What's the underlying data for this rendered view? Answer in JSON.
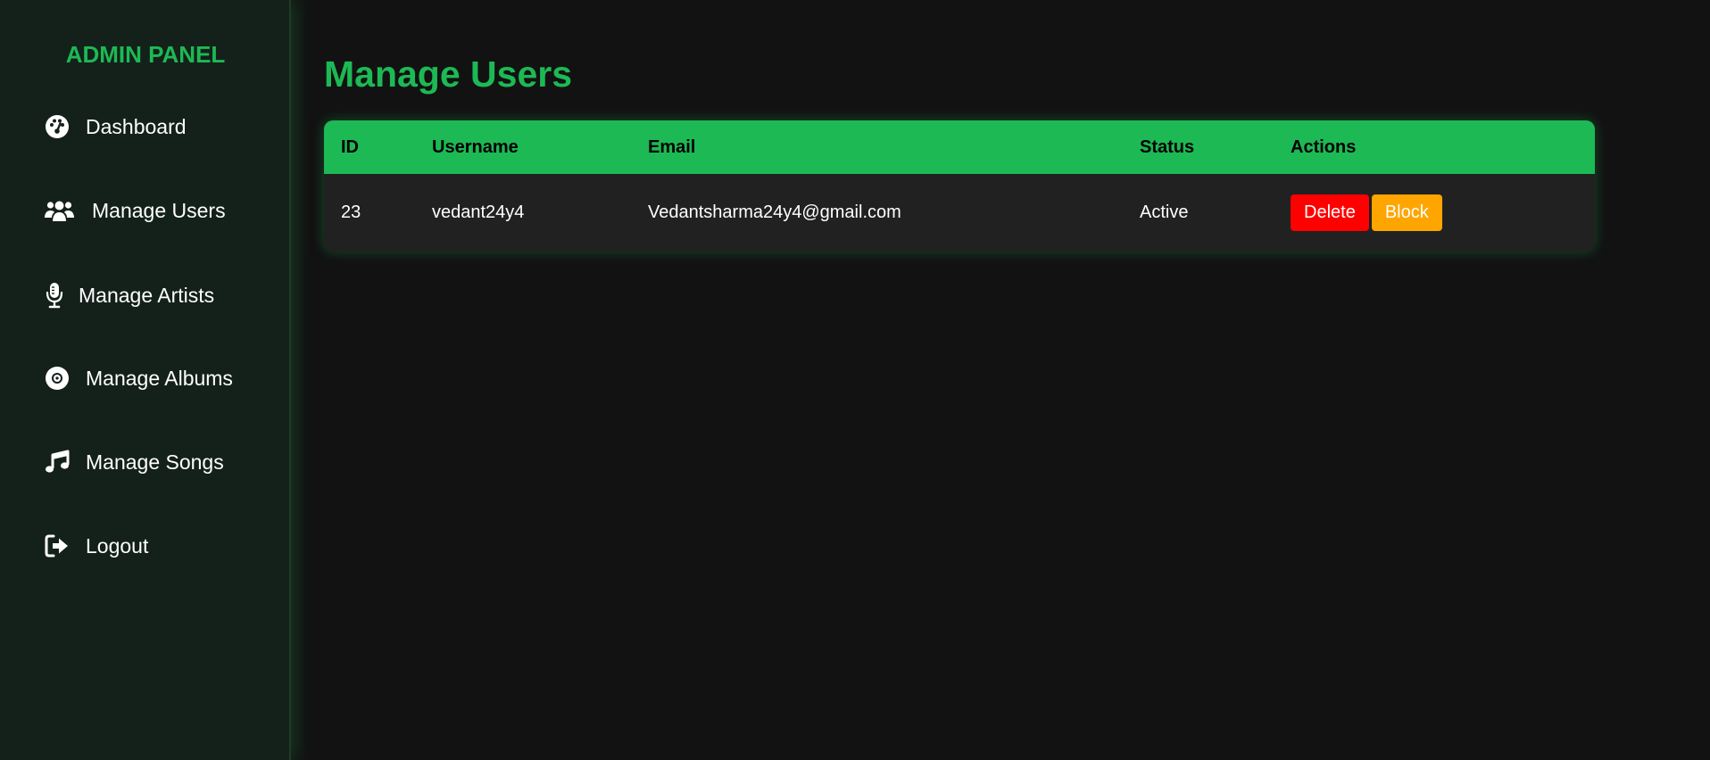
{
  "sidebar": {
    "brand": "ADMIN PANEL",
    "items": [
      {
        "label": "Dashboard",
        "icon": "gauge-icon"
      },
      {
        "label": "Manage Users",
        "icon": "users-icon"
      },
      {
        "label": "Manage Artists",
        "icon": "microphone-icon"
      },
      {
        "label": "Manage Albums",
        "icon": "compact-disc-icon"
      },
      {
        "label": "Manage Songs",
        "icon": "music-note-icon"
      },
      {
        "label": "Logout",
        "icon": "sign-out-icon"
      }
    ]
  },
  "main": {
    "title": "Manage Users",
    "table": {
      "headers": [
        "ID",
        "Username",
        "Email",
        "Status",
        "Actions"
      ],
      "rows": [
        {
          "id": "23",
          "username": "vedant24y4",
          "email": "Vedantsharma24y4@gmail.com",
          "status": "Active",
          "delete_label": "Delete",
          "block_label": "Block"
        }
      ]
    }
  },
  "colors": {
    "accent": "#1db954",
    "background": "#121212",
    "sidebar": "#14211b",
    "row": "#212121",
    "delete": "#ff0000",
    "block": "#ffa500"
  }
}
